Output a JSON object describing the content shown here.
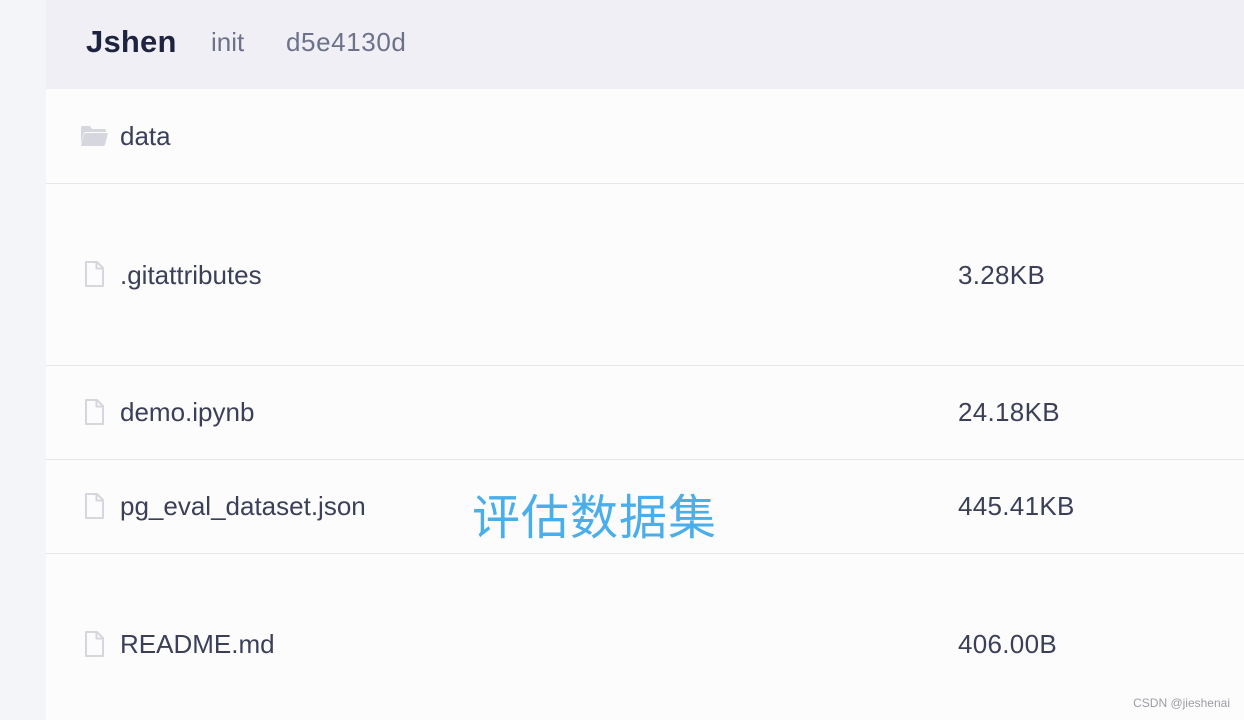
{
  "commit": {
    "author": "Jshen",
    "message": "init",
    "hash": "d5e4130d"
  },
  "files": [
    {
      "name": "data",
      "type": "folder",
      "icon": "folder-icon",
      "size": ""
    },
    {
      "name": ".gitattributes",
      "type": "file",
      "icon": "file-icon",
      "size": "3.28KB"
    },
    {
      "name": "demo.ipynb",
      "type": "file",
      "icon": "file-icon",
      "size": "24.18KB"
    },
    {
      "name": "pg_eval_dataset.json",
      "type": "file",
      "icon": "file-icon",
      "size": "445.41KB"
    },
    {
      "name": "README.md",
      "type": "file",
      "icon": "file-icon",
      "size": "406.00B"
    }
  ],
  "annotation": "评估数据集",
  "watermark": "CSDN @jieshenai",
  "colors": {
    "header_bg": "#efeff5",
    "text": "#3b3f57",
    "muted": "#6d7289",
    "annotation": "#4aaeea",
    "icon": "#d6d7de"
  }
}
